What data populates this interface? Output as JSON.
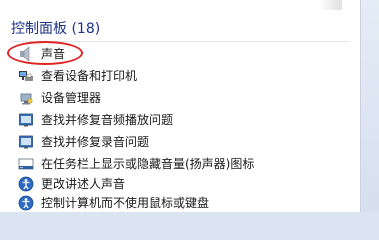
{
  "header": {
    "title": "控制面板 (18)"
  },
  "items": [
    {
      "label": "声音",
      "icon": "speaker-icon"
    },
    {
      "label": "查看设备和打印机",
      "icon": "printer-icon"
    },
    {
      "label": "设备管理器",
      "icon": "device-manager-icon"
    },
    {
      "label": "查找并修复音频播放问题",
      "icon": "troubleshoot-icon"
    },
    {
      "label": "查找并修复录音问题",
      "icon": "troubleshoot-icon"
    },
    {
      "label": "在任务栏上显示或隐藏音量(扬声器)图标",
      "icon": "taskbar-icon"
    },
    {
      "label": "更改讲述人声音",
      "icon": "ease-of-access-icon"
    },
    {
      "label": "控制计算机而不使用鼠标或键盘",
      "icon": "ease-of-access-icon"
    }
  ],
  "colors": {
    "header_text": "#1e3287",
    "highlight_ring": "#e02424"
  }
}
